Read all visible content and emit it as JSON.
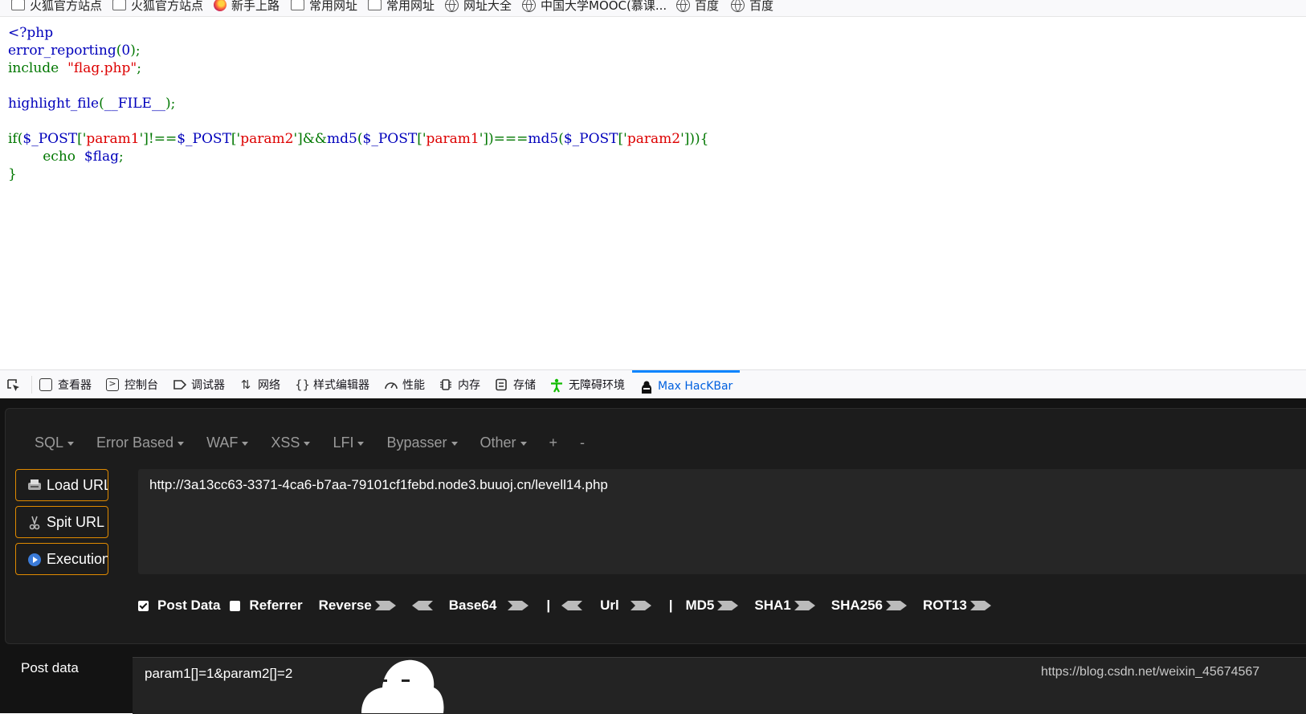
{
  "bookmarks": [
    {
      "label": "火狐官方站点",
      "icon": "folder-icon"
    },
    {
      "label": "火狐官方站点",
      "icon": "folder-icon"
    },
    {
      "label": "新手上路",
      "icon": "firefox-icon"
    },
    {
      "label": "常用网址",
      "icon": "folder-icon"
    },
    {
      "label": "常用网址",
      "icon": "folder-icon"
    },
    {
      "label": "网址大全",
      "icon": "globe-icon"
    },
    {
      "label": "中国大学MOOC(慕课...",
      "icon": "globe-icon"
    },
    {
      "label": "百度",
      "icon": "globe-icon"
    },
    {
      "label": "百度",
      "icon": "globe-icon"
    }
  ],
  "code": {
    "line1": "<?php",
    "line2_fn": "error_reporting",
    "line2_paren_open": "(",
    "line2_arg": "0",
    "line2_end": ");",
    "line3_kw": "include",
    "line3_str": "\"flag.php\"",
    "line3_end": ";",
    "line5_fn": "highlight_file",
    "line5_open": "(",
    "line5_arg": "__FILE__",
    "line5_end": ");",
    "line7_a": "if(",
    "line7_b": "$_POST",
    "line7_c": "['",
    "line7_d": "param1",
    "line7_e": "']!==",
    "line7_f": "$_POST",
    "line7_g": "['",
    "line7_h": "param2",
    "line7_i": "']&&",
    "line7_j": "md5",
    "line7_k": "(",
    "line7_l": "$_POST",
    "line7_m": "['",
    "line7_n": "param1",
    "line7_o": "'])===",
    "line7_p": "md5",
    "line7_q": "(",
    "line7_r": "$_POST",
    "line7_s": "['",
    "line7_t": "param2",
    "line7_u": "'])){",
    "line8_kw": "echo",
    "line8_var": "$flag",
    "line8_end": ";",
    "line9": "}"
  },
  "devtools": {
    "tabs": [
      {
        "label": "查看器",
        "icon": "inspector-icon"
      },
      {
        "label": "控制台",
        "icon": "console-icon"
      },
      {
        "label": "调试器",
        "icon": "debugger-icon"
      },
      {
        "label": "网络",
        "icon": "network-icon"
      },
      {
        "label": "样式编辑器",
        "icon": "style-editor-icon"
      },
      {
        "label": "性能",
        "icon": "performance-icon"
      },
      {
        "label": "内存",
        "icon": "memory-icon"
      },
      {
        "label": "存储",
        "icon": "storage-icon"
      },
      {
        "label": "无障碍环境",
        "icon": "accessibility-icon"
      },
      {
        "label": "Max HacKBar",
        "icon": "hackbar-icon",
        "active": true
      }
    ]
  },
  "hackbar": {
    "menu": [
      "SQL",
      "Error Based",
      "WAF",
      "XSS",
      "LFI",
      "Bypasser",
      "Other",
      "+",
      "-"
    ],
    "buttons": {
      "load": "Load URL",
      "split": "Spit URL",
      "execute": "Execution"
    },
    "url": "http://3a13cc63-3371-4ca6-b7aa-79101cf1febd.node3.buuoj.cn/levell14.php",
    "options": {
      "post_data": "Post Data",
      "post_data_checked": true,
      "referrer": "Referrer",
      "referrer_checked": false,
      "reverse": "Reverse",
      "base64": "Base64",
      "sep": "|",
      "url": "Url",
      "md5": "MD5",
      "sha1": "SHA1",
      "sha256": "SHA256",
      "rot13": "ROT13"
    },
    "post_label": "Post data",
    "post_value": "param1[]=1&param2[]=2"
  },
  "watermark": "https://blog.csdn.net/weixin_45674567",
  "colors": {
    "accent": "#0a84ff",
    "button_border": "#e08a00",
    "php_keyword": "#007700",
    "php_string": "#dd0000",
    "php_default": "#0000bb"
  }
}
